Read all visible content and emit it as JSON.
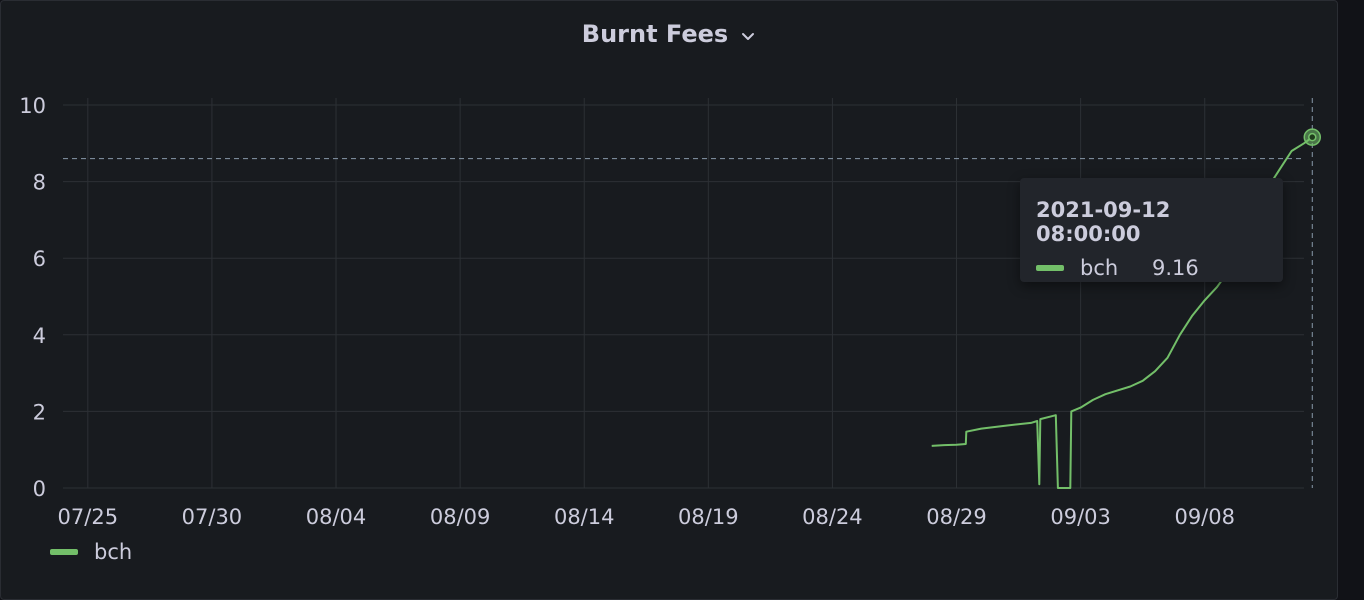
{
  "panel": {
    "title": "Burnt Fees"
  },
  "colors": {
    "background": "#181b1f",
    "grid": "#2c3035",
    "text": "#ccccdc",
    "series": "#73bf69",
    "crosshair": "#8899aa"
  },
  "chart_data": {
    "type": "line",
    "title": "Burnt Fees",
    "xlabel": "",
    "ylabel": "",
    "x_start": "2021-07-25",
    "x_range": [
      "2021-07-24",
      "2021-09-12"
    ],
    "x_ticks": [
      "07/25",
      "07/30",
      "08/04",
      "08/09",
      "08/14",
      "08/19",
      "08/24",
      "08/29",
      "09/03",
      "09/08"
    ],
    "ylim": [
      0,
      10
    ],
    "y_ticks": [
      0,
      2,
      4,
      6,
      8,
      10
    ],
    "grid": true,
    "legend_position": "bottom-left",
    "series": [
      {
        "name": "bch",
        "color": "#73bf69",
        "points": [
          [
            "2021-08-28",
            1.1
          ],
          [
            "2021-08-28T12:00",
            1.12
          ],
          [
            "2021-08-29",
            1.13
          ],
          [
            "2021-08-29T09:00",
            1.15
          ],
          [
            "2021-08-29T09:30",
            1.47
          ],
          [
            "2021-08-30",
            1.55
          ],
          [
            "2021-08-31",
            1.63
          ],
          [
            "2021-09-01",
            1.7
          ],
          [
            "2021-09-01T06:00",
            1.75
          ],
          [
            "2021-09-01T08:00",
            0.1
          ],
          [
            "2021-09-01T09:00",
            1.8
          ],
          [
            "2021-09-02",
            1.9
          ],
          [
            "2021-09-02T02:00",
            0.0
          ],
          [
            "2021-09-02T14:00",
            0.0
          ],
          [
            "2021-09-02T15:00",
            2.0
          ],
          [
            "2021-09-03",
            2.1
          ],
          [
            "2021-09-03T12:00",
            2.3
          ],
          [
            "2021-09-04",
            2.45
          ],
          [
            "2021-09-05",
            2.65
          ],
          [
            "2021-09-05T12:00",
            2.8
          ],
          [
            "2021-09-06",
            3.05
          ],
          [
            "2021-09-06T12:00",
            3.4
          ],
          [
            "2021-09-07",
            4.0
          ],
          [
            "2021-09-07T12:00",
            4.5
          ],
          [
            "2021-09-08",
            4.9
          ],
          [
            "2021-09-08T12:00",
            5.25
          ],
          [
            "2021-09-09",
            5.7
          ],
          [
            "2021-09-09T12:00",
            6.3
          ],
          [
            "2021-09-10",
            7.1
          ],
          [
            "2021-09-10T12:00",
            7.8
          ],
          [
            "2021-09-11",
            8.3
          ],
          [
            "2021-09-11T12:00",
            8.8
          ],
          [
            "2021-09-12",
            9.0
          ],
          [
            "2021-09-12T08:00",
            9.16
          ]
        ]
      }
    ],
    "hover": {
      "time": "2021-09-12 08:00:00",
      "series": "bch",
      "value": "9.16",
      "y_crosshair": 8.6
    }
  }
}
